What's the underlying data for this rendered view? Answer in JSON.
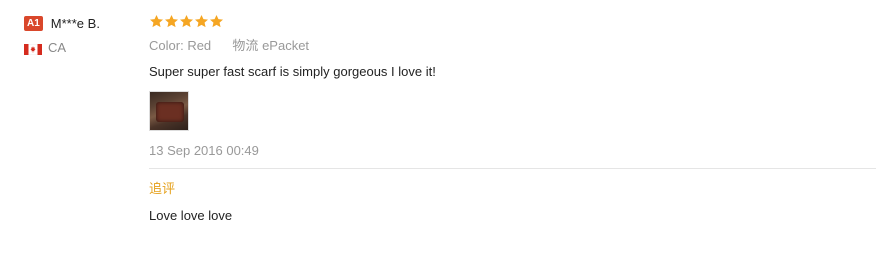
{
  "user": {
    "level": "A1",
    "name": "M***e B.",
    "country": "CA",
    "flag_icon": "canada-flag-icon"
  },
  "review": {
    "rating": 5,
    "star_color": "#f5a623",
    "color_key": "Color:",
    "color_value": "Red",
    "logistics_key": "物流",
    "logistics_value": "ePacket",
    "text": "Super super fast scarf is simply gorgeous I love it!",
    "date": "13 Sep 2016 00:49"
  },
  "followup": {
    "label": "追评",
    "text": "Love love love",
    "label_color": "#e5a01a"
  }
}
